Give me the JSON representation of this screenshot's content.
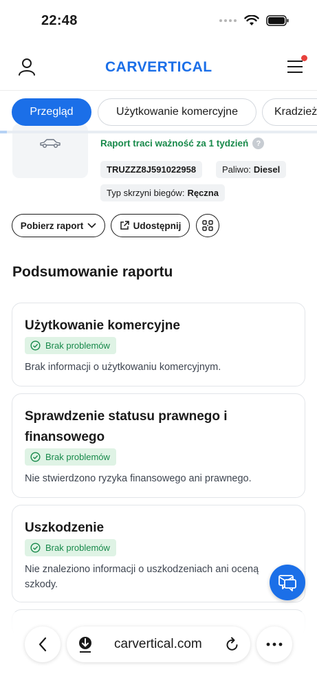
{
  "status_bar": {
    "time": "22:48"
  },
  "nav": {
    "logo_part1": "CAR",
    "logo_part2": "VERTICAL",
    "notification": true
  },
  "tabs": [
    {
      "label": "Przegląd",
      "active": true
    },
    {
      "label": "Użytkowanie komercyjne",
      "active": false
    },
    {
      "label": "Kradzież",
      "active": false
    }
  ],
  "vehicle": {
    "validity": "Raport traci ważność za 1 tydzień",
    "help": "?",
    "vin": "TRUZZZ8J591022958",
    "fuel_label": "Paliwo:",
    "fuel_value": "Diesel",
    "gearbox_label": "Typ skrzyni biegów:",
    "gearbox_value": "Ręczna"
  },
  "actions": {
    "download": "Pobierz raport",
    "share": "Udostępnij"
  },
  "summary": {
    "title": "Podsumowanie raportu",
    "cards": [
      {
        "title": "Użytkowanie komercyjne",
        "badge": "Brak problemów",
        "desc": "Brak informacji o użytkowaniu komercyjnym."
      },
      {
        "title": "Sprawdzenie statusu prawnego i finansowego",
        "badge": "Brak problemów",
        "desc": "Nie stwierdzono ryzyka finansowego ani prawnego."
      },
      {
        "title": "Uszkodzenie",
        "badge": "Brak problemów",
        "desc": "Nie znaleziono informacji o uszkodzeniach ani oceną szkody."
      }
    ]
  },
  "browser": {
    "url": "carvertical.com"
  },
  "colors": {
    "brand": "#1b6fe8",
    "success": "#17894a",
    "success_bg": "#dff3e5",
    "alert": "#e8413c"
  }
}
